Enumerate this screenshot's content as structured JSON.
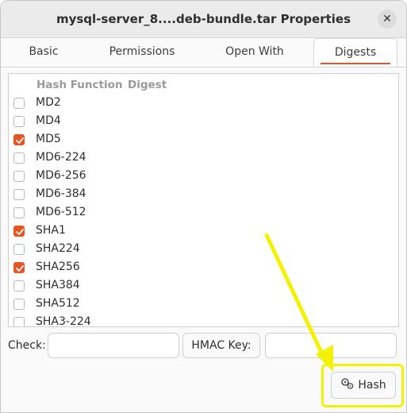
{
  "window": {
    "title": "mysql-server_8....deb-bundle.tar Properties"
  },
  "tabs": [
    {
      "label": "Basic"
    },
    {
      "label": "Permissions"
    },
    {
      "label": "Open With"
    },
    {
      "label": "Digests"
    }
  ],
  "list": {
    "columns": [
      "Hash Function",
      "Digest"
    ],
    "items": [
      {
        "label": "MD2",
        "checked": false
      },
      {
        "label": "MD4",
        "checked": false
      },
      {
        "label": "MD5",
        "checked": true
      },
      {
        "label": "MD6-224",
        "checked": false
      },
      {
        "label": "MD6-256",
        "checked": false
      },
      {
        "label": "MD6-384",
        "checked": false
      },
      {
        "label": "MD6-512",
        "checked": false
      },
      {
        "label": "SHA1",
        "checked": true
      },
      {
        "label": "SHA224",
        "checked": false
      },
      {
        "label": "SHA256",
        "checked": true
      },
      {
        "label": "SHA384",
        "checked": false
      },
      {
        "label": "SHA512",
        "checked": false
      },
      {
        "label": "SHA3-224",
        "checked": false
      }
    ]
  },
  "bottom": {
    "check_label": "Check:",
    "check_value": "",
    "hmac_label": "HMAC Key:",
    "hmac_value": ""
  },
  "hash_button": {
    "label": "Hash",
    "icon": "gears-icon"
  },
  "colors": {
    "accent": "#e95420",
    "highlight": "#f5f200"
  }
}
